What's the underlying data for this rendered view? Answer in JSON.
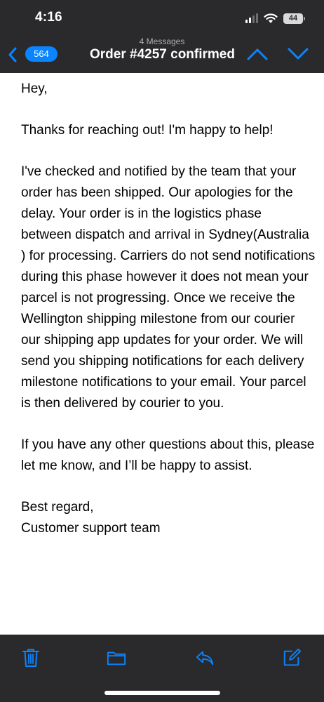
{
  "status_bar": {
    "time": "4:16",
    "battery": "44",
    "icons": [
      "signal-icon",
      "wifi-icon",
      "battery-icon"
    ]
  },
  "nav": {
    "back_count": "564",
    "subtitle": "4 Messages",
    "title": "Order #4257 confirmed",
    "icons": [
      "chevron-left-icon",
      "chevron-up-icon",
      "chevron-down-icon"
    ],
    "accent": "#0a84ff"
  },
  "message": {
    "greeting": "Hey,",
    "thanks": "Thanks for reaching out! I'm happy to help!",
    "details": "I've checked and notified by the team that your order has been shipped. Our apologies for the delay. Your order is in the logistics phase between dispatch and arrival in Sydney(Australia ) for processing. Carriers do not send notifications during this phase however it does not mean your parcel is not progressing. Once we receive the Wellington shipping milestone from our courier our shipping app updates for your order. We will send you shipping notifications for each delivery milestone notifications to your email. Your parcel is then delivered by courier to you.",
    "closing": "If you have any other questions about this, please let me know, and I’ll be happy to assist.",
    "signoff": "Best regard,",
    "signature": "Customer support team"
  },
  "toolbar": {
    "icons": [
      "trash-icon",
      "folder-icon",
      "reply-icon",
      "compose-icon"
    ],
    "accent": "#0a84ff"
  }
}
